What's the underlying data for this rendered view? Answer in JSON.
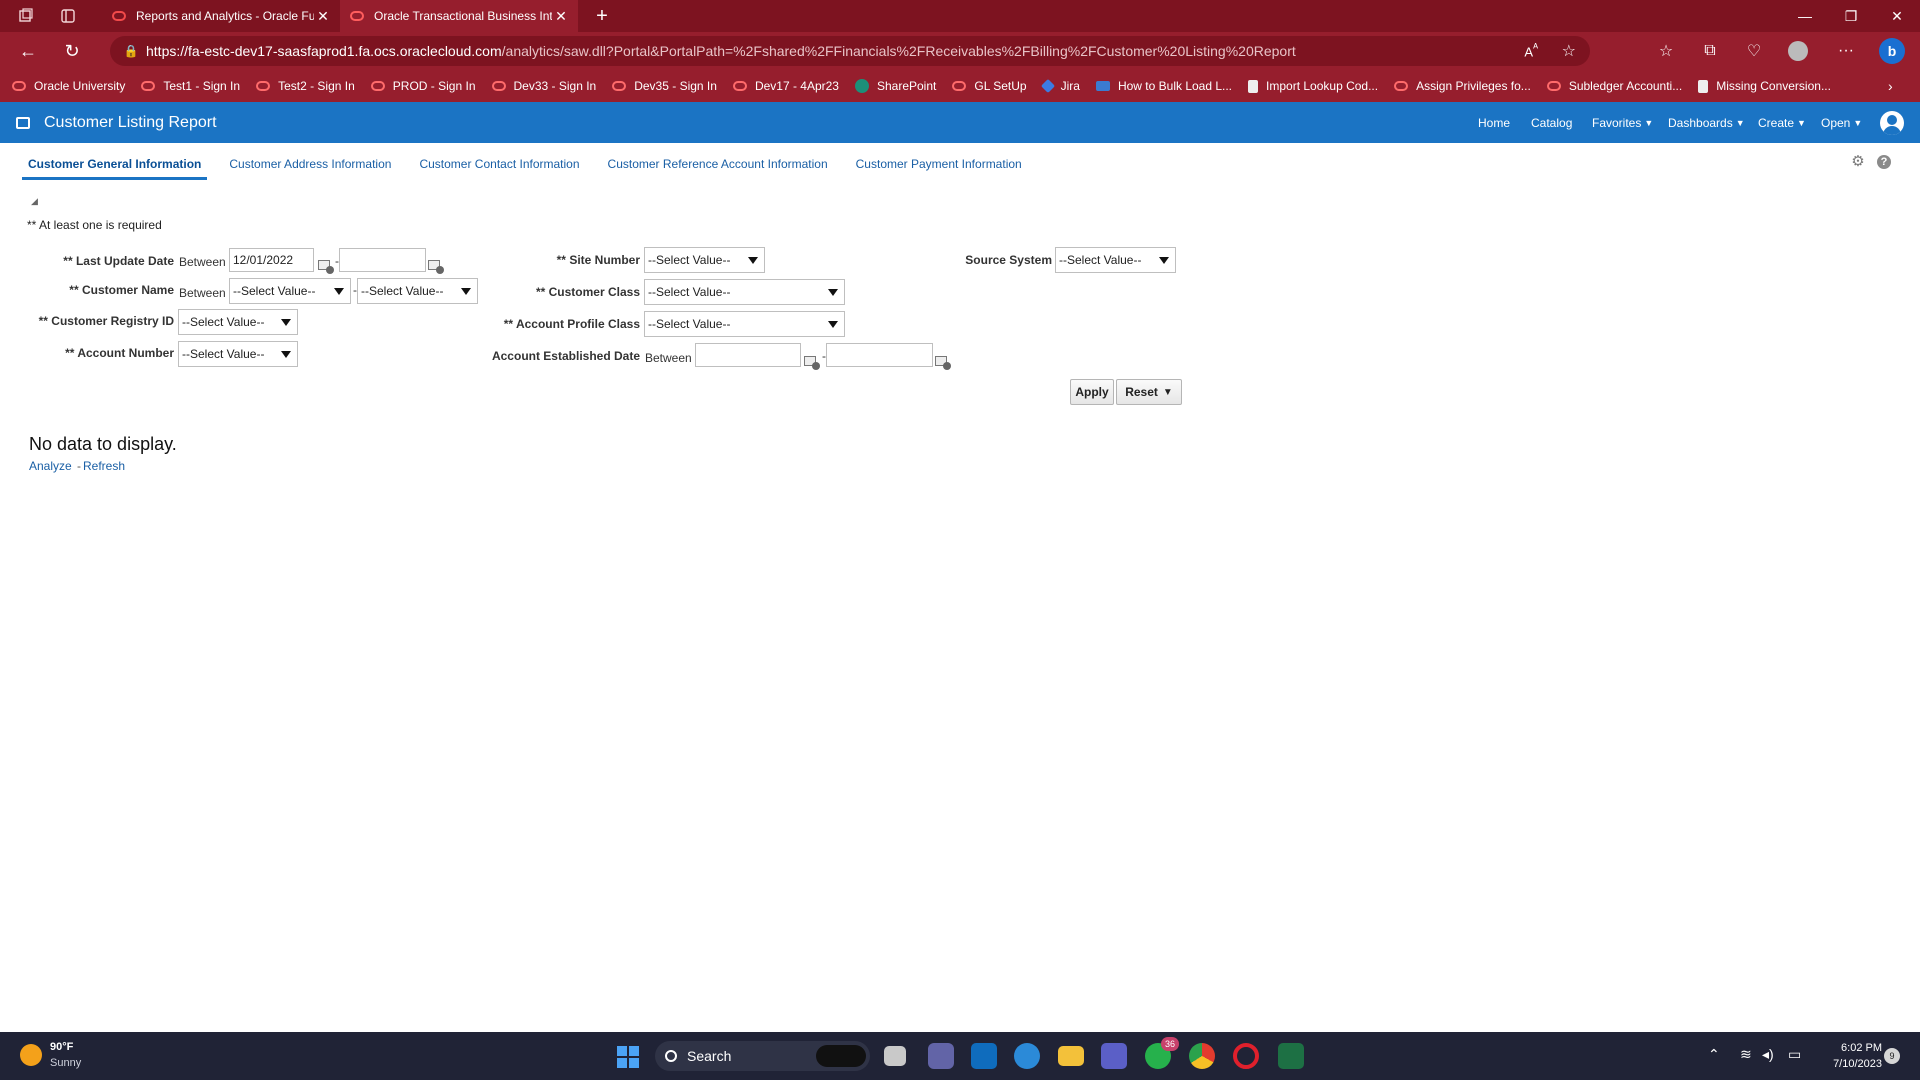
{
  "browser": {
    "tabs": [
      {
        "title": "Reports and Analytics - Oracle Fu",
        "active": false
      },
      {
        "title": "Oracle Transactional Business Int",
        "active": true
      }
    ],
    "url_host": "https://fa-estc-dev17-saasfaprod1.fa.ocs.oraclecloud.com",
    "url_path": "/analytics/saw.dll?Portal&PortalPath=%2Fshared%2FFinancials%2FReceivables%2FBilling%2FCustomer%20Listing%20Report",
    "bookmarks": [
      "Oracle University",
      "Test1 - Sign In",
      "Test2 - Sign In",
      "PROD - Sign In",
      "Dev33 - Sign In",
      "Dev35 - Sign In",
      "Dev17 - 4Apr23",
      "SharePoint",
      "GL SetUp",
      "Jira",
      "How to Bulk Load L...",
      "Import Lookup Cod...",
      "Assign Privileges fo...",
      "Subledger Accounti...",
      "Missing Conversion..."
    ]
  },
  "app": {
    "title": "Customer Listing Report",
    "nav": {
      "home": "Home",
      "catalog": "Catalog",
      "favorites": "Favorites",
      "dashboards": "Dashboards",
      "create": "Create",
      "open": "Open"
    }
  },
  "report_tabs": [
    "Customer General Information",
    "Customer Address Information",
    "Customer Contact Information",
    "Customer Reference Account Information",
    "Customer Payment Information"
  ],
  "prompts": {
    "required_note": "** At least one is required",
    "between": "Between",
    "last_update_date": {
      "label": "** Last Update Date",
      "from": "12/01/2022",
      "to": ""
    },
    "customer_name": {
      "label": "** Customer Name",
      "from": "--Select Value--",
      "to": "--Select Value--"
    },
    "customer_registry_id": {
      "label": "** Customer Registry ID",
      "value": "--Select Value--"
    },
    "account_number": {
      "label": "** Account Number",
      "value": "--Select Value--"
    },
    "site_number": {
      "label": "** Site Number",
      "value": "--Select Value--"
    },
    "customer_class": {
      "label": "** Customer Class",
      "value": "--Select Value--"
    },
    "account_profile_class": {
      "label": "** Account Profile Class",
      "value": "--Select Value--"
    },
    "account_established_date": {
      "label": "Account Established Date",
      "from": "",
      "to": ""
    },
    "source_system": {
      "label": "Source System",
      "value": "--Select Value--"
    },
    "apply": "Apply",
    "reset": "Reset"
  },
  "results": {
    "no_data": "No data to display.",
    "analyze": "Analyze",
    "refresh": "Refresh"
  },
  "taskbar": {
    "temp": "90°F",
    "condition": "Sunny",
    "search": "Search",
    "whatsapp_badge": "36",
    "time": "6:02 PM",
    "date": "7/10/2023",
    "notifications": "9"
  }
}
